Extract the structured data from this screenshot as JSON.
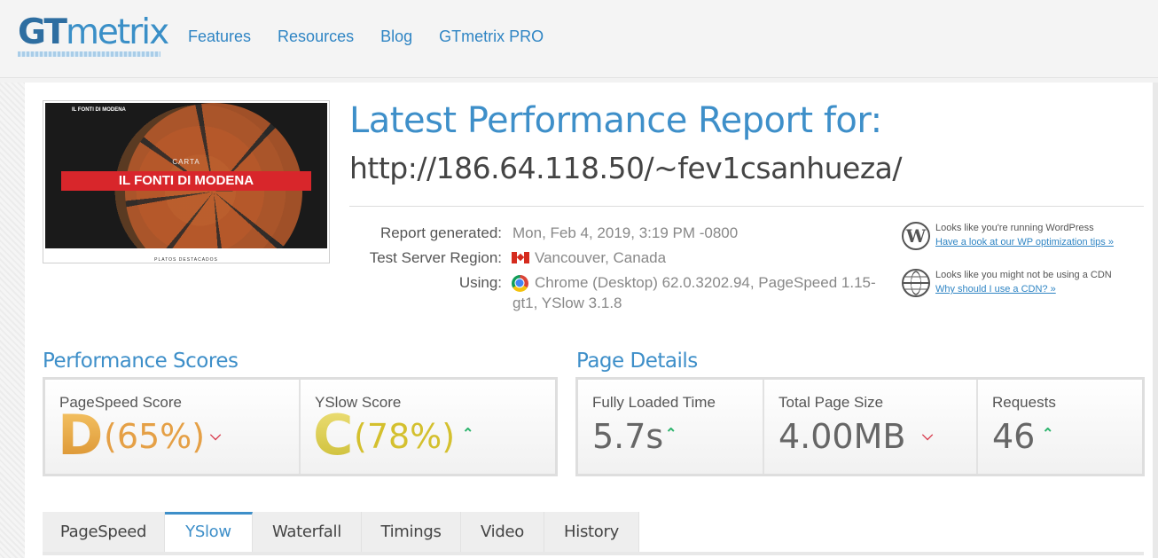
{
  "header": {
    "logo_gt": "GT",
    "logo_metrix": "metrix",
    "nav": [
      "Features",
      "Resources",
      "Blog",
      "GTmetrix PRO"
    ]
  },
  "thumbnail": {
    "banner": "IL FONTI DI MODENA",
    "subtitle": "CARTA",
    "site_logo": "IL FONTI DI MODENA",
    "footer": "PLATOS DESTACADOS"
  },
  "report": {
    "title": "Latest Performance Report for:",
    "url": "http://186.64.118.50/~fev1csanhueza/",
    "generated_label": "Report generated:",
    "generated_value": "Mon, Feb 4, 2019, 3:19 PM -0800",
    "region_label": "Test Server Region:",
    "region_value": "Vancouver, Canada",
    "using_label": "Using:",
    "using_value_line1": "Chrome (Desktop) 62.0.3202.94, PageSpeed 1.15-",
    "using_value_line2": "gt1, YSlow 3.1.8"
  },
  "notices": {
    "wordpress_text": "Looks like you're running WordPress",
    "wordpress_link": "Have a look at our WP optimization tips »",
    "cdn_text": "Looks like you might not be using a CDN",
    "cdn_link": "Why should I use a CDN? »"
  },
  "performance_scores": {
    "heading": "Performance Scores",
    "pagespeed": {
      "label": "PageSpeed Score",
      "grade": "D",
      "percent": "(65%)",
      "trend": "down"
    },
    "yslow": {
      "label": "YSlow Score",
      "grade": "C",
      "percent": "(78%)",
      "trend": "up"
    }
  },
  "page_details": {
    "heading": "Page Details",
    "load_time": {
      "label": "Fully Loaded Time",
      "value": "5.7s",
      "trend": "up"
    },
    "page_size": {
      "label": "Total Page Size",
      "value": "4.00MB",
      "trend": "down"
    },
    "requests": {
      "label": "Requests",
      "value": "46",
      "trend": "up"
    }
  },
  "tabs": [
    "PageSpeed",
    "YSlow",
    "Waterfall",
    "Timings",
    "Video",
    "History"
  ],
  "active_tab": "YSlow",
  "icons": {
    "arrow_up": "ⱏ",
    "arrow_down": "˅"
  },
  "colors": {
    "accent": "#3e8fc9",
    "grade_d": "#e5a046",
    "grade_c": "#d4c02e",
    "trend_up": "#2db46d",
    "trend_down": "#d94052"
  }
}
